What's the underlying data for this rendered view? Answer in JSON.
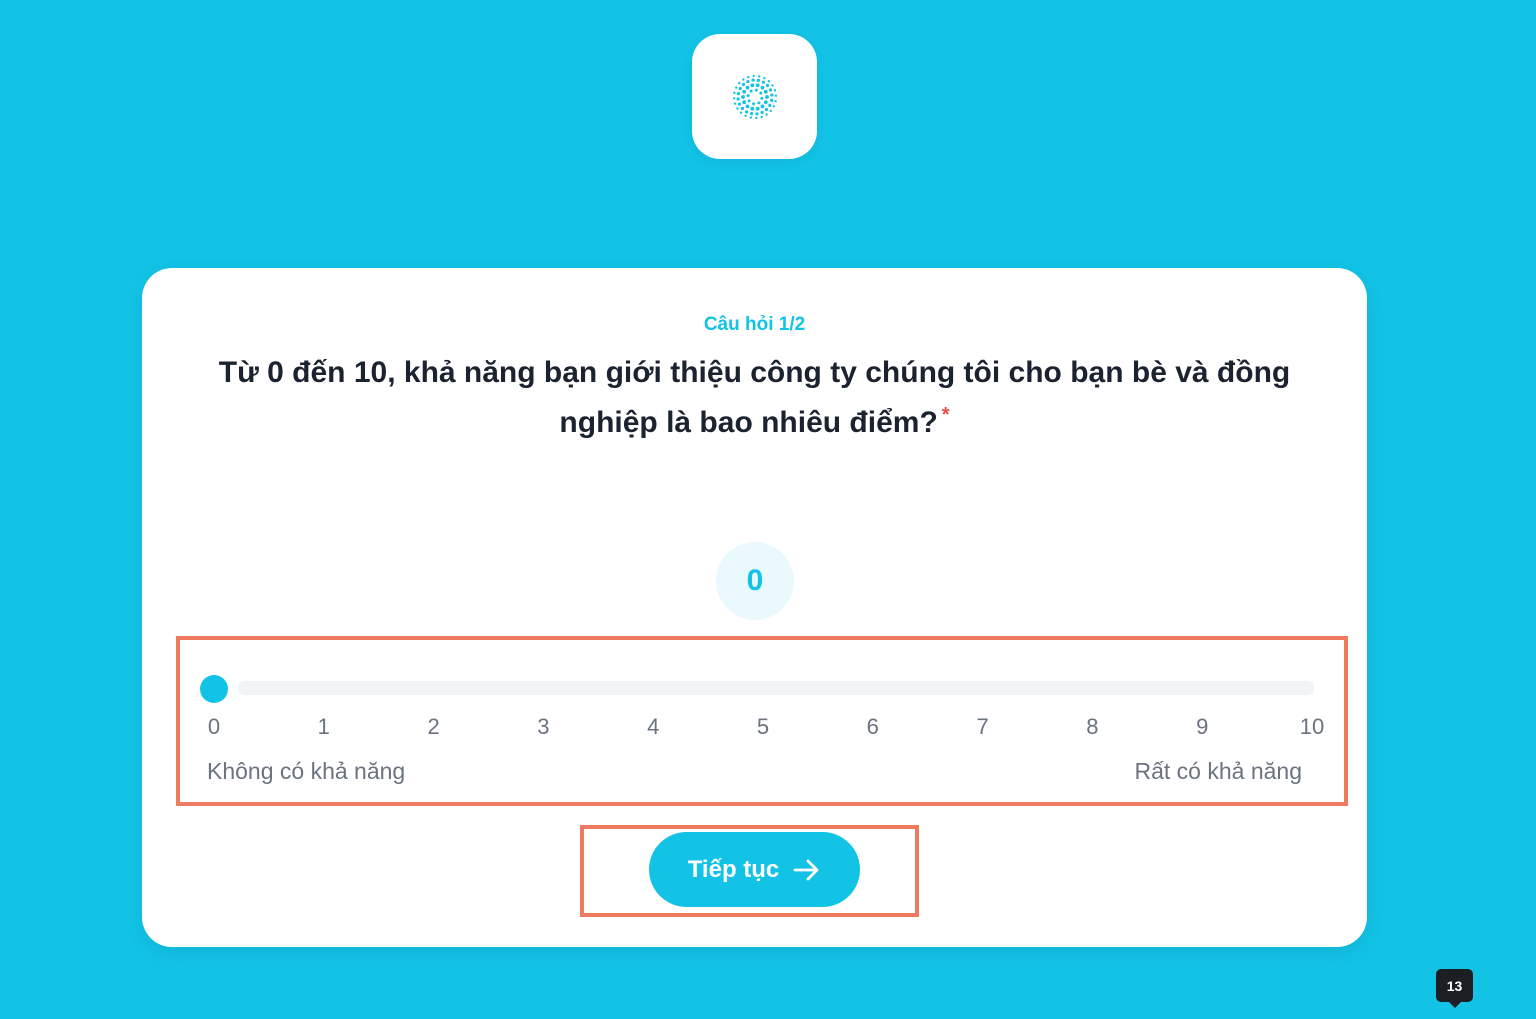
{
  "logo": {
    "icon": "dotted-sunburst-logo-icon",
    "color": "#12c3e6"
  },
  "survey": {
    "counter": "Câu hỏi 1/2",
    "question": "Từ 0 đến 10, khả năng bạn giới thiệu công ty chúng tôi cho bạn bè và đồng nghiệp là bao nhiêu điểm?",
    "required_mark": "*",
    "value_display": "0",
    "slider": {
      "value": 0,
      "min": 0,
      "max": 10,
      "ticks": [
        "0",
        "1",
        "2",
        "3",
        "4",
        "5",
        "6",
        "7",
        "8",
        "9",
        "10"
      ],
      "low_label": "Không có khả năng",
      "high_label": "Rất có khả năng"
    },
    "next_button": {
      "label": "Tiếp tục",
      "icon": "arrow-right-icon"
    }
  },
  "page_badge": "13",
  "colors": {
    "background": "#12c3e6",
    "accent": "#12c3e6",
    "highlight": "#ee7a5f",
    "required": "#ef4a4a"
  }
}
